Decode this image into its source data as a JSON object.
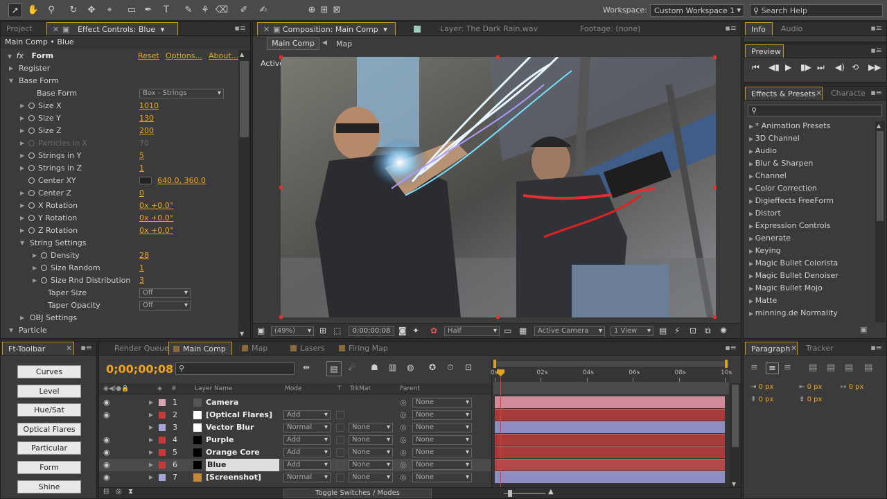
{
  "toolbar": {
    "workspace_label": "Workspace:",
    "workspace_value": "Custom Workspace 1",
    "search_placeholder": "Search Help"
  },
  "project_panel": {
    "tab_project": "Project",
    "tab_effect_controls": "Effect Controls: Blue",
    "breadcrumb": "Main Comp • Blue",
    "effect": {
      "fx": "fx",
      "name": "Form",
      "reset": "Reset",
      "options": "Options...",
      "about": "About..."
    },
    "properties": [
      {
        "label": "Register",
        "value": "",
        "kind": "group"
      },
      {
        "label": "Base Form",
        "value": "",
        "kind": "group-open"
      },
      {
        "label": "Base Form",
        "value": "Box - Strings",
        "kind": "dropdown"
      },
      {
        "label": "Size X",
        "value": "1010",
        "kind": "prop"
      },
      {
        "label": "Size Y",
        "value": "130",
        "kind": "prop"
      },
      {
        "label": "Size Z",
        "value": "200",
        "kind": "prop"
      },
      {
        "label": "Particles in X",
        "value": "70",
        "kind": "prop-dim"
      },
      {
        "label": "Strings in Y",
        "value": "5",
        "kind": "prop"
      },
      {
        "label": "Strings in Z",
        "value": "1",
        "kind": "prop"
      },
      {
        "label": "Center XY",
        "value": "640.0, 360.0",
        "kind": "point"
      },
      {
        "label": "Center Z",
        "value": "0",
        "kind": "prop"
      },
      {
        "label": "X Rotation",
        "value": "0x +0.0°",
        "kind": "prop"
      },
      {
        "label": "Y Rotation",
        "value": "0x +0.0°",
        "kind": "prop"
      },
      {
        "label": "Z Rotation",
        "value": "0x +0.0°",
        "kind": "prop"
      },
      {
        "label": "String Settings",
        "value": "",
        "kind": "subgroup-open"
      },
      {
        "label": "Density",
        "value": "28",
        "kind": "subprop"
      },
      {
        "label": "Size Random",
        "value": "1",
        "kind": "subprop"
      },
      {
        "label": "Size Rnd Distribution",
        "value": "3",
        "kind": "subprop"
      },
      {
        "label": "Taper Size",
        "value": "Off",
        "kind": "subdropdown"
      },
      {
        "label": "Taper Opacity",
        "value": "Off",
        "kind": "subdropdown"
      },
      {
        "label": "OBJ Settings",
        "value": "",
        "kind": "subgroup"
      },
      {
        "label": "Particle",
        "value": "",
        "kind": "group-open"
      }
    ]
  },
  "composition_panel": {
    "tab_composition": "Composition: Main Comp",
    "tab_layer": "Layer: The Dark Rain.wav",
    "tab_footage": "Footage: (none)",
    "flow_main": "Main Comp",
    "flow_map": "Map",
    "view_label": "Active Camera",
    "zoom": "(49%)",
    "timecode": "0;00;00;08",
    "resolution": "Half",
    "camera": "Active Camera",
    "views": "1 View"
  },
  "info_panel": {
    "tab_info": "Info",
    "tab_audio": "Audio"
  },
  "preview_panel": {
    "title": "Preview"
  },
  "effects_panel": {
    "tab_effects": "Effects & Presets",
    "tab_character": "Characte",
    "categories": [
      "* Animation Presets",
      "3D Channel",
      "Audio",
      "Blur & Sharpen",
      "Channel",
      "Color Correction",
      "Digieffects FreeForm",
      "Distort",
      "Expression Controls",
      "Generate",
      "Keying",
      "Magic Bullet Colorista",
      "Magic Bullet Denoiser",
      "Magic Bullet Mojo",
      "Matte",
      "minning.de Normality"
    ]
  },
  "ft_toolbar": {
    "title": "Ft-Toolbar",
    "buttons": [
      "Curves",
      "Level",
      "Hue/Sat",
      "Optical Flares",
      "Particular",
      "Form",
      "Shine"
    ]
  },
  "timeline": {
    "tabs": [
      "Render Queue",
      "Main Comp",
      "Map",
      "Lasers",
      "Firing Map"
    ],
    "timecode": "0;00;00;08",
    "col_layer_name": "Layer Name",
    "col_mode": "Mode",
    "col_t": "T",
    "col_trkmat": "TrkMat",
    "col_parent": "Parent",
    "ruler": [
      "0s",
      "02s",
      "04s",
      "06s",
      "08s",
      "10s"
    ],
    "layers": [
      {
        "num": "1",
        "name": "Camera",
        "mode": "",
        "trkmat": "",
        "parent": "None",
        "label": "#d8a3b3",
        "bar": "#d08a9a"
      },
      {
        "num": "2",
        "name": "[Optical Flares]",
        "mode": "Add",
        "trkmat": "",
        "parent": "None",
        "label": "#c43a3a",
        "bar": "#a83a3a"
      },
      {
        "num": "3",
        "name": "Vector Blur",
        "mode": "Normal",
        "trkmat": "None",
        "parent": "None",
        "label": "#a6a6d6",
        "bar": "#8e8ec2"
      },
      {
        "num": "4",
        "name": "Purple",
        "mode": "Add",
        "trkmat": "None",
        "parent": "None",
        "label": "#c43a3a",
        "bar": "#a83a3a"
      },
      {
        "num": "5",
        "name": "Orange Core",
        "mode": "Add",
        "trkmat": "None",
        "parent": "None",
        "label": "#c43a3a",
        "bar": "#a83a3a"
      },
      {
        "num": "6",
        "name": "Blue",
        "mode": "Add",
        "trkmat": "None",
        "parent": "None",
        "label": "#c43a3a",
        "bar": "#b24848"
      },
      {
        "num": "7",
        "name": "[Screenshot]",
        "mode": "Normal",
        "trkmat": "None",
        "parent": "None",
        "label": "#a6a6d6",
        "bar": "#8e8ec2"
      }
    ],
    "toggle_label": "Toggle Switches / Modes"
  },
  "paragraph_panel": {
    "tab_paragraph": "Paragraph",
    "tab_tracker": "Tracker",
    "fields": [
      "0 px",
      "0 px",
      "0 px",
      "0 px",
      "0 px"
    ]
  }
}
